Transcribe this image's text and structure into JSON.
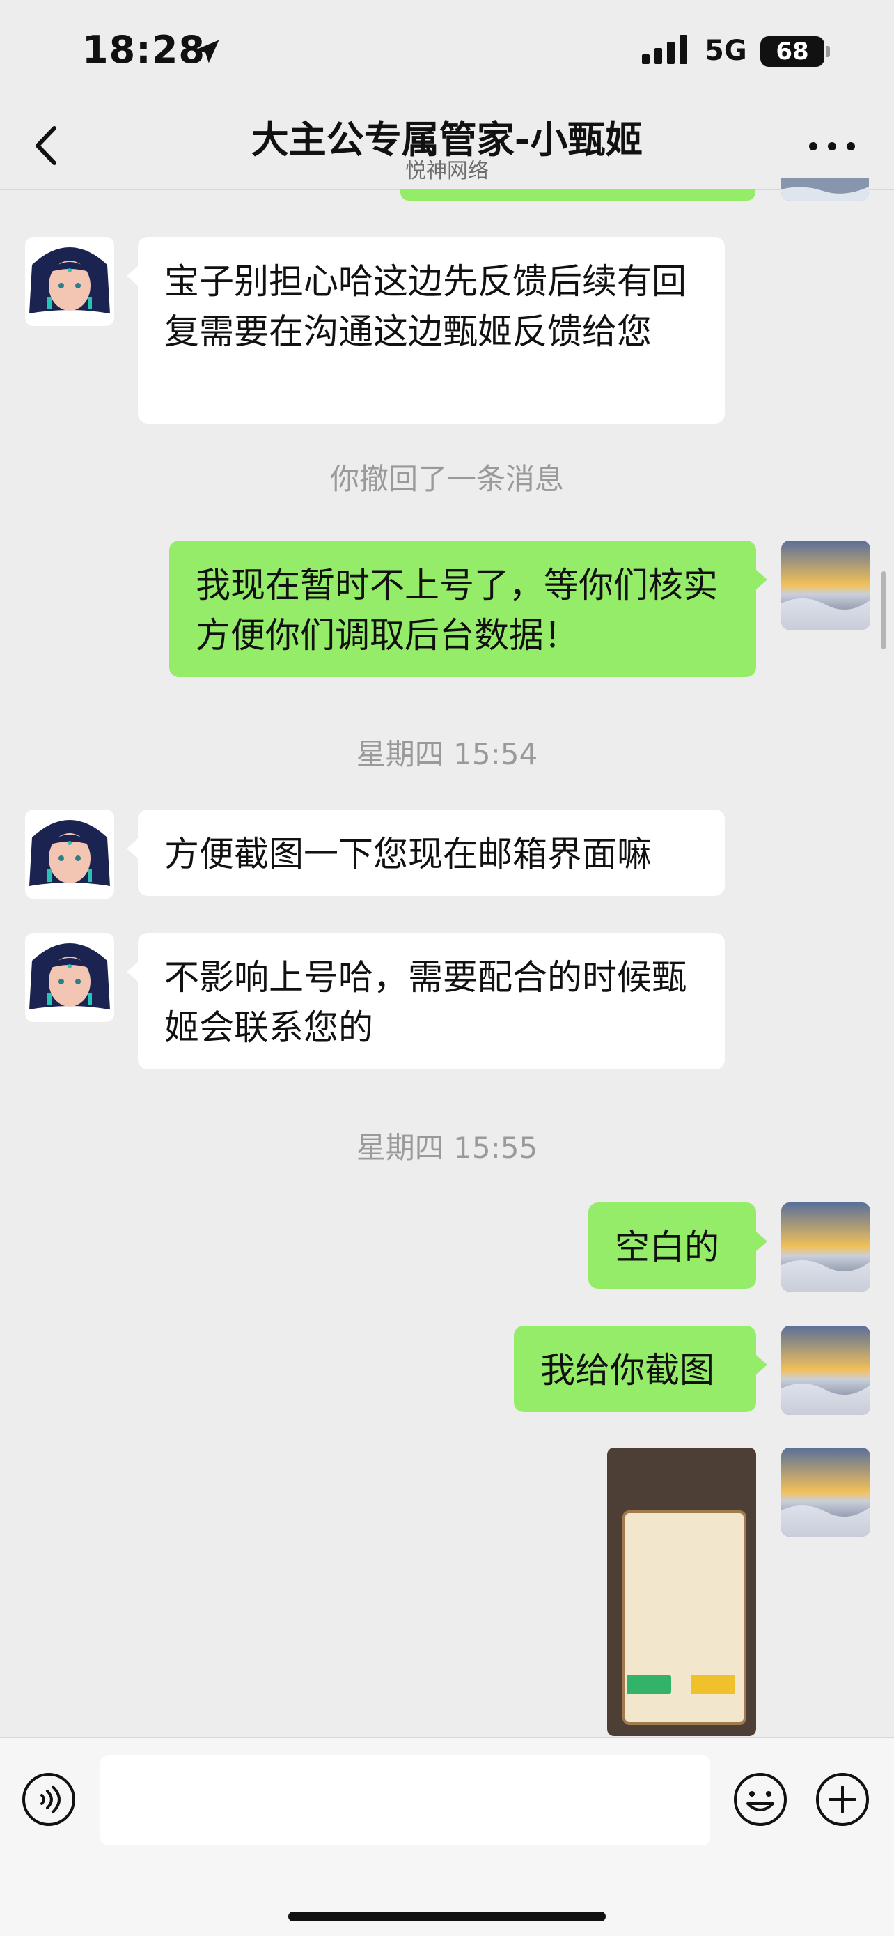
{
  "status": {
    "time": "18:28",
    "network": "5G",
    "battery": "68"
  },
  "nav": {
    "title": "大主公专属管家-小甄姬",
    "subtitle": "悦神网络"
  },
  "messages": {
    "m1": "宝子别担心哈这边先反馈后续有回复需要在沟通这边甄姬反馈给您",
    "recall": "你撤回了一条消息",
    "m2": "我现在暂时不上号了，等你们核实方便你们调取后台数据！",
    "time1": "星期四 15:54",
    "m3": "方便截图一下您现在邮箱界面嘛",
    "m4": "不影响上号哈，需要配合的时候甄姬会联系您的",
    "time2": "星期四 15:55",
    "m5": "空白的",
    "m6": "我给你截图"
  },
  "colors": {
    "outgoing": "#95ec69",
    "incoming": "#ffffff",
    "background": "#ededed"
  },
  "icons": [
    "location-arrow-icon",
    "signal-icon",
    "back-chevron-icon",
    "more-icon",
    "voice-icon",
    "emoji-icon",
    "plus-icon"
  ]
}
